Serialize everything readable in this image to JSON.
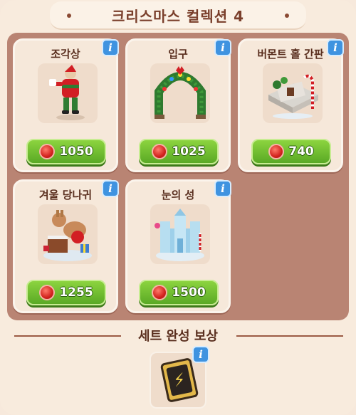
{
  "header": {
    "title": "크리스마스 컬렉션 4"
  },
  "items": [
    {
      "name": "조각상",
      "price": "1050",
      "icon": "santa-statue-icon"
    },
    {
      "name": "입구",
      "price": "1025",
      "icon": "christmas-arch-icon"
    },
    {
      "name": "버몬트 홀 간판",
      "price": "740",
      "icon": "vermont-hall-sign-icon"
    },
    {
      "name": "겨울 당나귀",
      "price": "1255",
      "icon": "winter-donkey-icon"
    },
    {
      "name": "눈의 성",
      "price": "1500",
      "icon": "snow-castle-icon"
    }
  ],
  "reward": {
    "title": "세트 완성 보상",
    "icon": "lightning-card-icon"
  },
  "colors": {
    "accent_green": "#6cbf2e",
    "info_blue": "#3f93e0",
    "coin_red": "#d2231e"
  }
}
